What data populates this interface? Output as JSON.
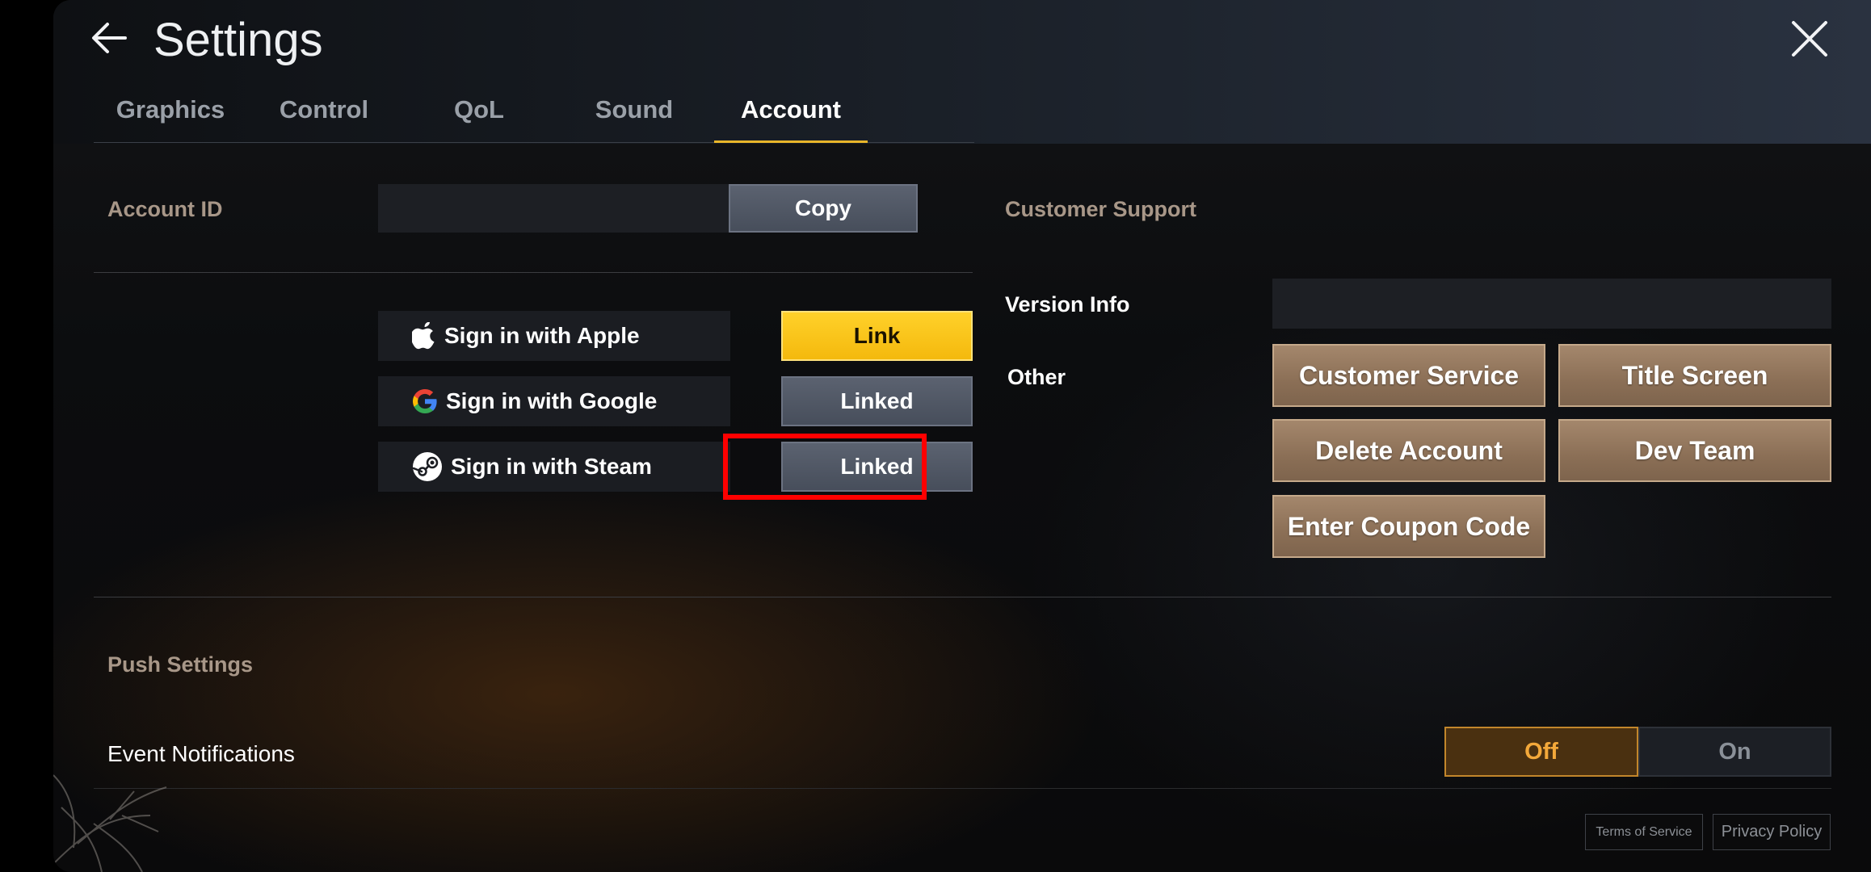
{
  "header": {
    "title": "Settings",
    "tabs": [
      {
        "label": "Graphics"
      },
      {
        "label": "Control"
      },
      {
        "label": "QoL"
      },
      {
        "label": "Sound"
      },
      {
        "label": "Account"
      }
    ],
    "active_tab": "Account"
  },
  "account": {
    "id_label": "Account ID",
    "id_value": "",
    "copy_label": "Copy",
    "signins": [
      {
        "label": "Sign in with Apple",
        "icon": "apple-icon",
        "action": "Link"
      },
      {
        "label": "Sign in with Google",
        "icon": "google-icon",
        "action": "Linked"
      },
      {
        "label": "Sign in with Steam",
        "icon": "steam-icon",
        "action": "Linked"
      }
    ]
  },
  "support": {
    "heading": "Customer Support",
    "version_label": "Version Info",
    "version_value": "",
    "other_label": "Other",
    "buttons": [
      {
        "label": "Customer Service"
      },
      {
        "label": "Title Screen"
      },
      {
        "label": "Delete Account"
      },
      {
        "label": "Dev Team"
      },
      {
        "label": "Enter Coupon Code"
      }
    ]
  },
  "push": {
    "heading": "Push Settings",
    "event_label": "Event Notifications",
    "off_label": "Off",
    "on_label": "On",
    "selected": "Off"
  },
  "footer": {
    "terms": "Terms of Service",
    "privacy": "Privacy Policy"
  },
  "colors": {
    "accent_yellow": "#f4b90d",
    "tab_underline": "#e9b62a",
    "highlight_red": "#ff0000",
    "brown_button": "#8b6f56",
    "off_orange": "#f3a83a"
  }
}
